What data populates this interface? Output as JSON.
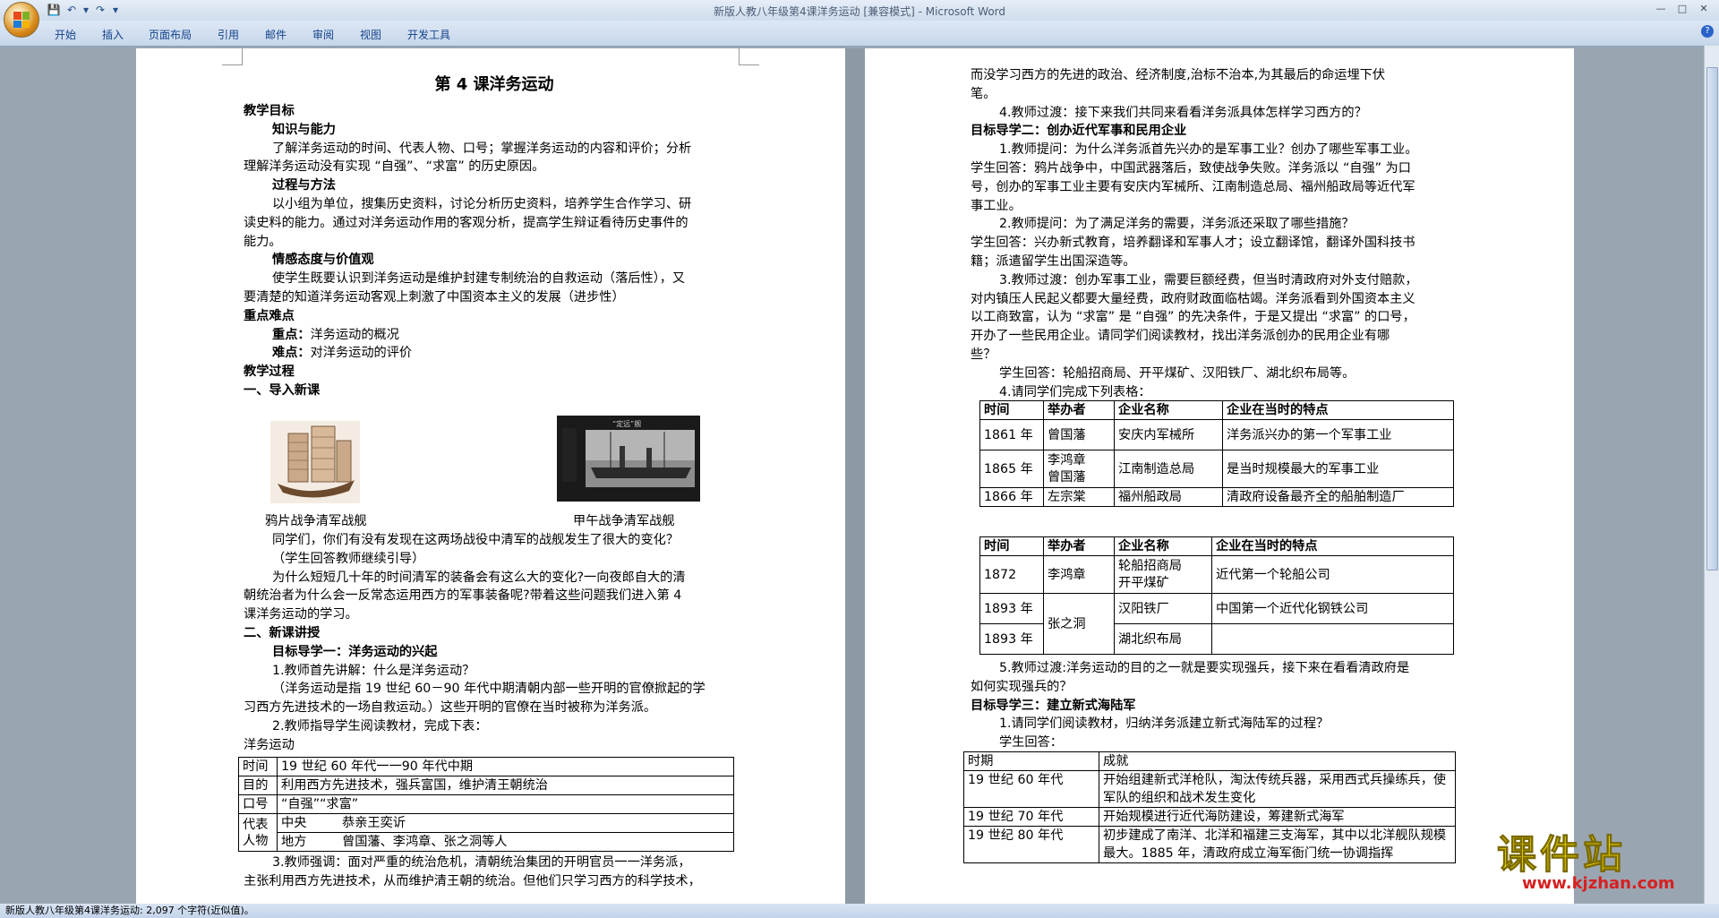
{
  "window": {
    "title": "新版人教八年级第4课洋务运动 [兼容模式] - Microsoft Word"
  },
  "ribbon": {
    "tabs": [
      "开始",
      "插入",
      "页面布局",
      "引用",
      "邮件",
      "审阅",
      "视图",
      "开发工具"
    ]
  },
  "status_bar": {
    "text": "新版人教八年级第4课洋务运动: 2,097 个字符(近似值)。"
  },
  "watermark": {
    "title": "课件站",
    "url": "www.kjzhan.com"
  },
  "page1": {
    "title": "第 4 课洋务运动",
    "p1": "教学目标",
    "p2": "知识与能力",
    "p3": "了解洋务运动的时间、代表人物、口号；掌握洋务运动的内容和评价；分析",
    "p4": "理解洋务运动没有实现 “自强”、“求富” 的历史原因。",
    "p5": "过程与方法",
    "p6": "以小组为单位，搜集历史资料，讨论分析历史资料，培养学生合作学习、研",
    "p7": "读史料的能力。通过对洋务运动作用的客观分析，提高学生辩证看待历史事件的",
    "p8": "能力。",
    "p9": "情感态度与价值观",
    "p10": "使学生既要认识到洋务运动是维护封建专制统治的自救运动（落后性），又",
    "p11": "要清楚的知道洋务运动客观上刺激了中国资本主义的发展（进步性）",
    "p12": "重点难点",
    "p13a": "重点：",
    "p13b": "洋务运动的概况",
    "p14a": "难点：",
    "p14b": "对洋务运动的评价",
    "p15": "教学过程",
    "p16": "一、导入新课",
    "cap1": "鸦片战争清军战舰",
    "cap2": "甲午战争清军战舰",
    "img2_label": "“定远”舰",
    "p17": "同学们，你们有没有发现在这两场战役中清军的战舰发生了很大的变化？",
    "p18": "（学生回答教师继续引导）",
    "p19": "为什么短短几十年的时间清军的装备会有这么大的变化?一向夜郎自大的清",
    "p20": "朝统治者为什么会一反常态运用西方的军事装备呢?带着这些问题我们进入第  4",
    "p21": "课洋务运动的学习。",
    "p22": "二、新课讲授",
    "p23": "目标导学一：洋务运动的兴起",
    "p24": "1.教师首先讲解：什么是洋务运动？",
    "p25": "（洋务运动是指 19 世纪 60－90 年代中期清朝内部一些开明的官僚掀起的学",
    "p26": "习西方先进技术的一场自救运动。）这些开明的官僚在当时被称为洋务派。",
    "p27": "2.教师指导学生阅读教材，完成下表：",
    "p28": "洋务运动",
    "tbl": {
      "r1": [
        "时间",
        "19 世纪 60 年代一一90 年代中期"
      ],
      "r2": [
        "目的",
        "利用西方先进技术，强兵富国，维护清王朝统治"
      ],
      "r3": [
        "口号",
        "“自强”“求富”"
      ],
      "r4a": "代表人物",
      "r4b": [
        "中央",
        "恭亲王奕䜣"
      ],
      "r4c": [
        "地方",
        "曾国藩、李鸿章、张之洞等人"
      ]
    },
    "p29": "3.教师强调：面对严重的统治危机，清朝统治集团的开明官员一一洋务派，",
    "p30": "主张利用西方先进技术，从而维护清王朝的统治。但他们只学习西方的科学技术，"
  },
  "page2": {
    "q1": "而没学习西方的先进的政治、经济制度,治标不治本,为其最后的命运埋下伏",
    "q2": "笔。",
    "q3": "4.教师过渡：接下来我们共同来看看洋务派具体怎样学习西方的？",
    "q4": "目标导学二：创办近代军事和民用企业",
    "q5": "1.教师提问：为什么洋务派首先兴办的是军事工业？创办了哪些军事工业。",
    "q6": "学生回答：鸦片战争中，中国武器落后，致使战争失败。洋务派以 “自强” 为口",
    "q7": "号，创办的军事工业主要有安庆内军械所、江南制造总局、福州船政局等近代军",
    "q8": "事工业。",
    "q9": "2.教师提问：为了满足洋务的需要，洋务派还采取了哪些措施？",
    "q10": "学生回答：兴办新式教育，培养翻译和军事人才；设立翻译馆，翻译外国科技书",
    "q11": "籍；派遣留学生出国深造等。",
    "q12": "3.教师过渡：创办军事工业，需要巨额经费，但当时清政府对外支付赔款，",
    "q13": "对内镇压人民起义都要大量经费，政府财政面临枯竭。洋务派看到外国资本主义",
    "q14": "以工商致富，认为 “求富” 是 “自强” 的先决条件，于是又提出 “求富” 的口号，",
    "q15": "开办了一些民用企业。请同学们阅读教材，找出洋务派创办的民用企业有哪",
    "q16": "些？",
    "q17": "学生回答：轮船招商局、开平煤矿、汉阳铁厂、湖北织布局等。",
    "q18": "4.请同学们完成下列表格：",
    "t1_headers": [
      "时间",
      "举办者",
      "企业名称",
      "企业在当时的特点"
    ],
    "t1_rows": [
      [
        "1861 年",
        "曾国藩",
        "安庆内军械所",
        "洋务派兴办的第一个军事工业"
      ],
      [
        "1865 年",
        "李鸿章\n曾国藩",
        "江南制造总局",
        "是当时规模最大的军事工业"
      ],
      [
        "1866 年",
        "左宗棠",
        "福州船政局",
        "清政府设备最齐全的船舶制造厂"
      ]
    ],
    "t2_headers": [
      "时间",
      "举办者",
      "企业名称",
      "企业在当时的特点"
    ],
    "t2_r1": [
      "1872",
      "李鸿章",
      "轮船招商局",
      "开平煤矿",
      "近代第一个轮船公司"
    ],
    "t2_r2": [
      "1893 年",
      "张之洞",
      "汉阳铁厂",
      "中国第一个近代化钢铁公司"
    ],
    "t2_r3": [
      "1893 年",
      "湖北织布局",
      ""
    ],
    "q19": "5.教师过渡:洋务运动的目的之一就是要实现强兵，接下来在看看清政府是",
    "q20": "如何实现强兵的？",
    "q21": "目标导学三：建立新式海陆军",
    "q22": "1.请同学们阅读教材，归纳洋务派建立新式海陆军的过程？",
    "q23": "学生回答：",
    "t3_headers": [
      "时期",
      "成就"
    ],
    "t3_rows": [
      [
        "19 世纪 60 年代",
        "开始组建新式洋枪队，淘汰传统兵器，采用西式兵操练兵，使军队的组织和战术发生变化"
      ],
      [
        "19 世纪 70 年代",
        "开始规模进行近代海防建设，筹建新式海军"
      ],
      [
        "19 世纪 80 年代",
        "初步建成了南洋、北洋和福建三支海军，其中以北洋舰队规模最大。1885 年，清政府成立海军衙门统一协调指挥"
      ]
    ]
  }
}
